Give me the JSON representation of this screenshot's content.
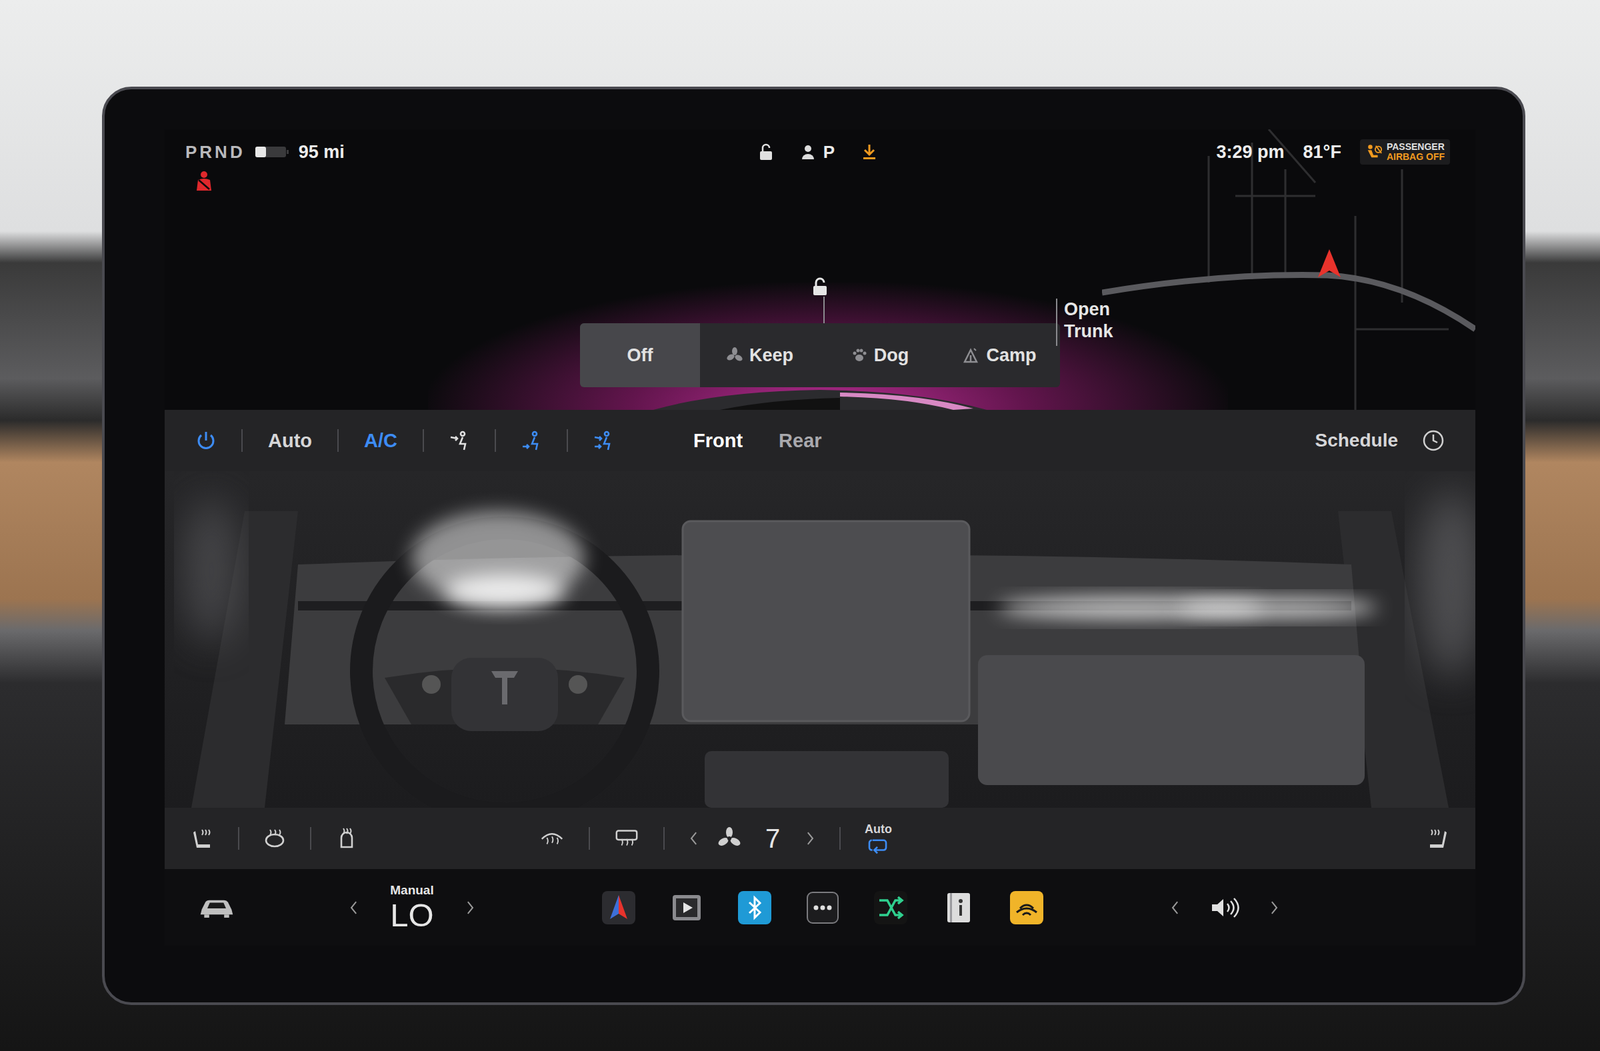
{
  "status_bar": {
    "gear": "PRND",
    "range": "95 mi",
    "profile": "P",
    "time": "3:29 pm",
    "temperature": "81°F",
    "airbag": {
      "line1": "PASSENGER",
      "line2": "AIRBAG OFF"
    }
  },
  "doors_locked": false,
  "modes": [
    {
      "label": "Off",
      "selected": true,
      "kind": "none"
    },
    {
      "label": "Keep",
      "selected": false,
      "kind": "keep"
    },
    {
      "label": "Dog",
      "selected": false,
      "kind": "dog"
    },
    {
      "label": "Camp",
      "selected": false,
      "kind": "camp"
    }
  ],
  "trunk": {
    "label": "Open Trunk"
  },
  "climate": {
    "power": true,
    "toggles": [
      {
        "label": "Auto",
        "on": false
      },
      {
        "label": "A/C",
        "on": true
      }
    ],
    "vents": [
      {
        "on": false
      },
      {
        "on": true
      },
      {
        "on": true
      }
    ],
    "zones": [
      {
        "label": "Front",
        "selected": true
      },
      {
        "label": "Rear",
        "selected": false
      }
    ],
    "schedule": "Schedule",
    "fan_speed": "7",
    "recirculation": "Auto"
  },
  "temperature_control": {
    "mode": "Manual",
    "value": "LO"
  }
}
